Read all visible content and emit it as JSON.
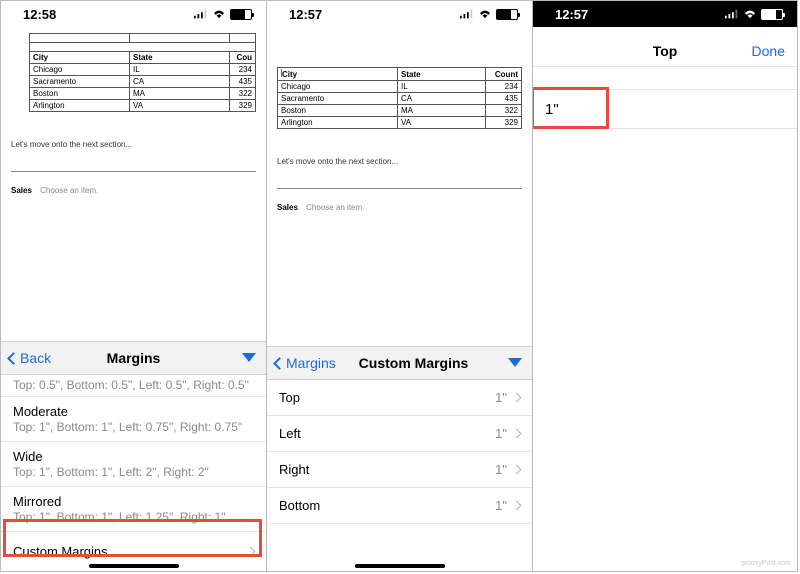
{
  "status": {
    "time1": "12:58",
    "time2": "12:57",
    "time3": "12:57"
  },
  "table": {
    "headers": {
      "city": "City",
      "state": "State",
      "count": "Count"
    },
    "header_city_trunc": "City",
    "header_count_trunc": "Cou",
    "rows": [
      {
        "city": "Chicago",
        "state": "IL",
        "count": "234"
      },
      {
        "city": "Sacramento",
        "state": "CA",
        "count": "435"
      },
      {
        "city": "Boston",
        "state": "MA",
        "count": "322"
      },
      {
        "city": "Arlington",
        "state": "VA",
        "count": "329"
      }
    ]
  },
  "doc": {
    "section_text": "Let's move onto the next section...",
    "sales_label": "Sales",
    "choose_item": "Choose an item."
  },
  "pane1_sheet": {
    "back": "Back",
    "title": "Margins",
    "partial_sub": "Top: 0.5\", Bottom: 0.5\", Left: 0.5\", Right: 0.5\"",
    "options": [
      {
        "title": "Moderate",
        "sub": "Top: 1\", Bottom: 1\", Left: 0.75\", Right: 0.75\""
      },
      {
        "title": "Wide",
        "sub": "Top: 1\", Bottom: 1\", Left: 2\", Right: 2\""
      },
      {
        "title": "Mirrored",
        "sub": "Top: 1\", Bottom: 1\", Left: 1.25\", Right: 1\""
      }
    ],
    "custom": "Custom Margins"
  },
  "pane2_sheet": {
    "back": "Margins",
    "title": "Custom Margins",
    "rows": [
      {
        "label": "Top",
        "value": "1\""
      },
      {
        "label": "Left",
        "value": "1\""
      },
      {
        "label": "Right",
        "value": "1\""
      },
      {
        "label": "Bottom",
        "value": "1\""
      }
    ]
  },
  "pane3": {
    "title": "Top",
    "done": "Done",
    "value": "1\""
  },
  "watermark": "groovyPost.com"
}
